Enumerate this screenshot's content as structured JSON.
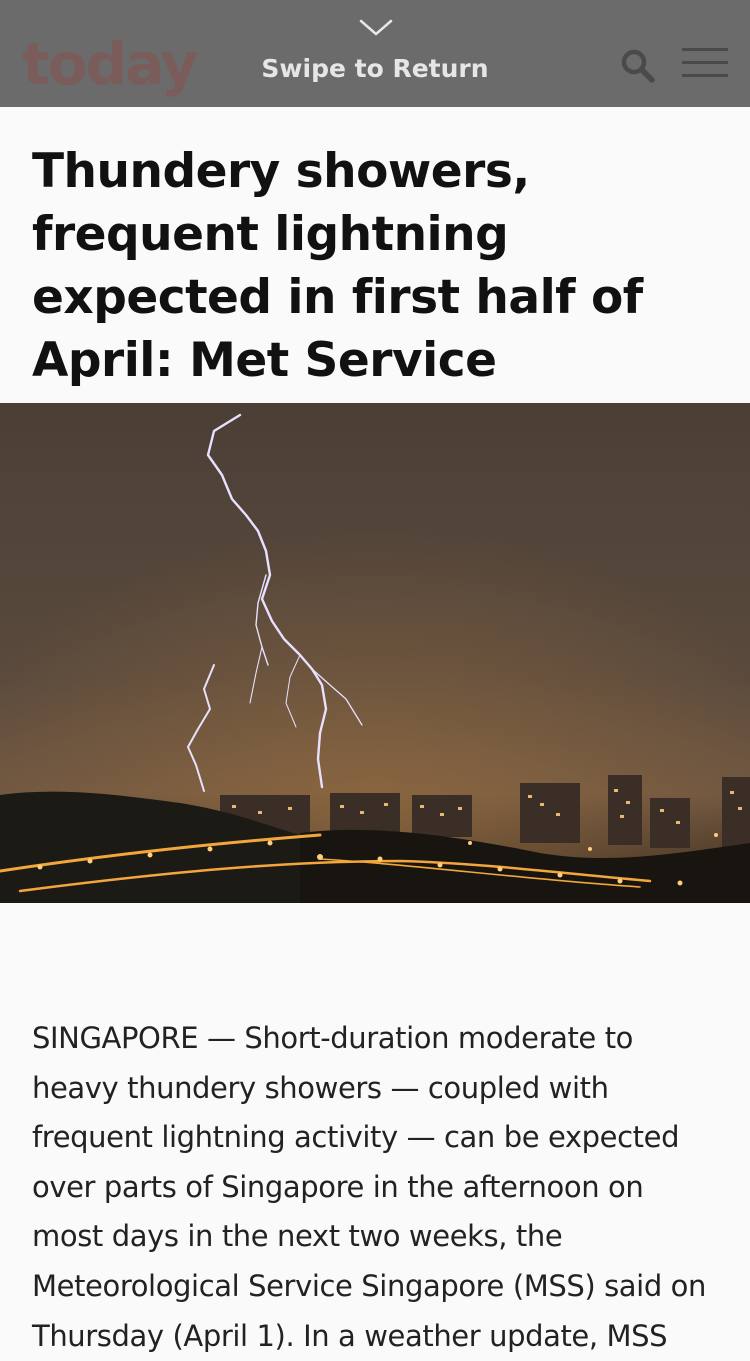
{
  "header": {
    "logo_text": "today",
    "swipe_label": "Swipe to Return",
    "search_icon": "search-icon",
    "menu_icon": "menu-icon",
    "chevron_icon": "chevron-down-icon"
  },
  "article": {
    "title": "Thundery showers, frequent lightning expected in first half of April: Met Service",
    "hero_image": "lightning-over-city-night",
    "body": "SINGAPORE — Short-duration moderate to heavy thundery showers — coupled with frequent lightning activity — can be expected over parts of Singapore in the afternoon on most days in the next two weeks, the Meteorological Service Singapore (MSS) said on Thursday (April 1). In a weather update, MSS"
  },
  "colors": {
    "header_bg": "#6b6b6b",
    "logo": "#7a5d5a",
    "page_bg": "#fafafa",
    "title_text": "#111111",
    "body_text": "#222222"
  }
}
